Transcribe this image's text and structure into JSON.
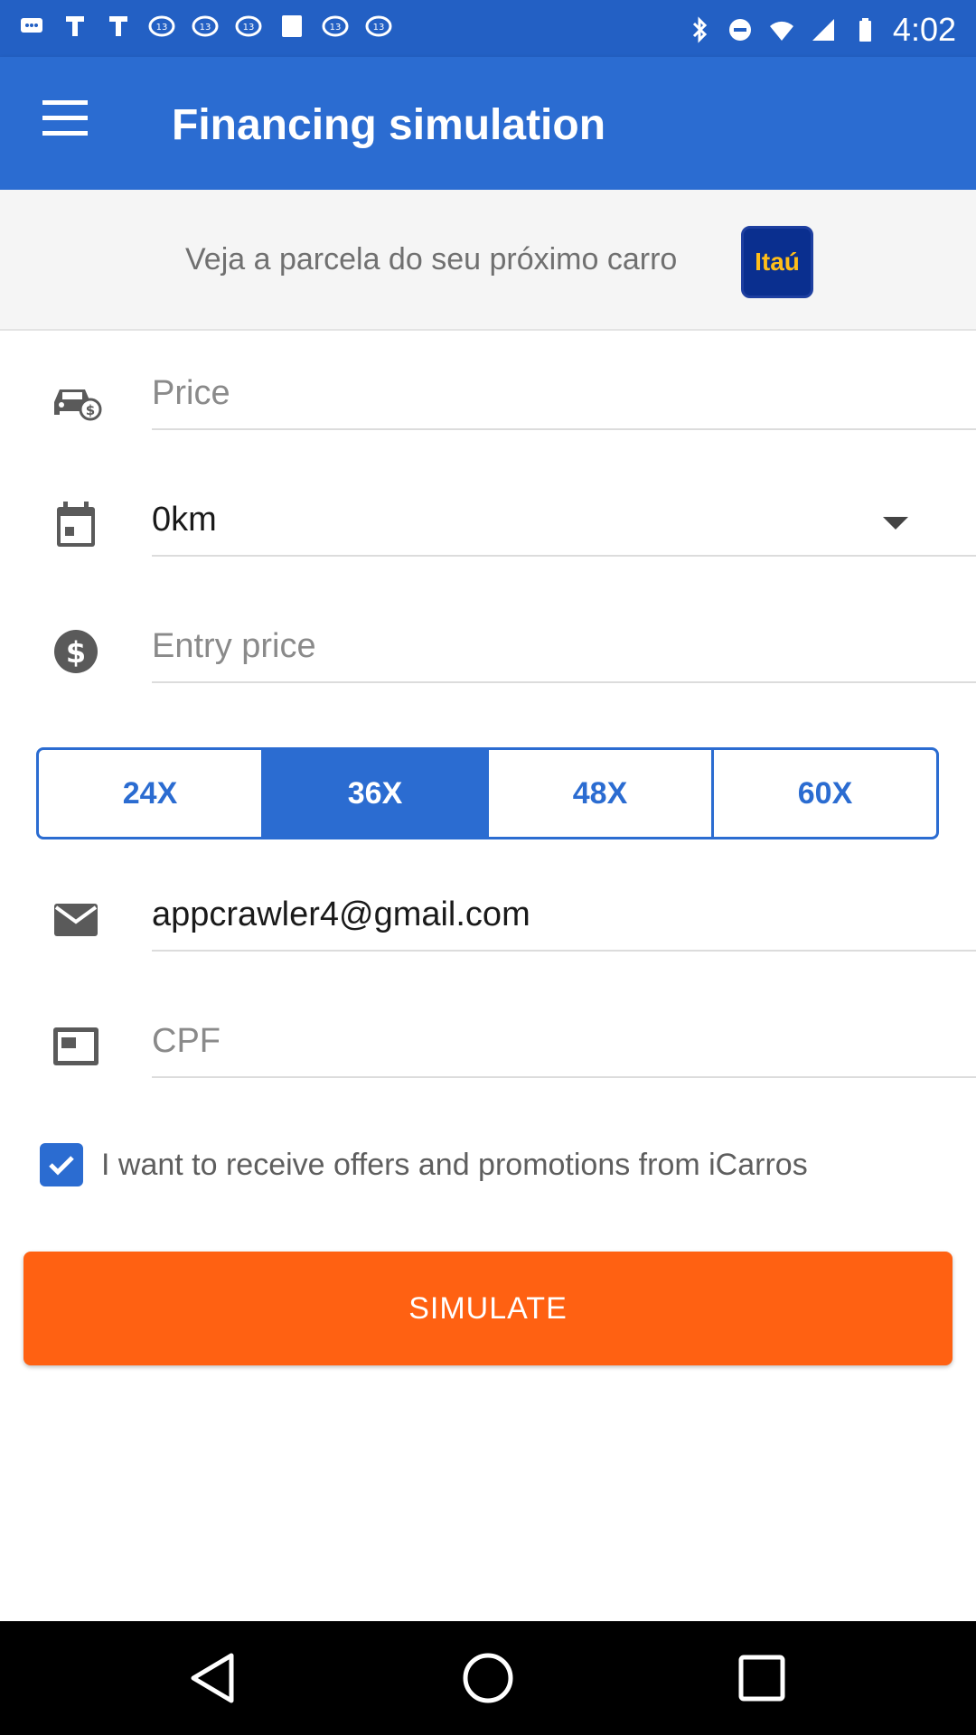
{
  "status_bar": {
    "time": "4:02",
    "left_icons": [
      "messages-icon",
      "notification-icon",
      "notification-icon",
      "tv-channel-icon",
      "tv-channel-icon",
      "tv-channel-icon",
      "blank-notification-icon",
      "tv-channel-icon",
      "tv-channel-icon"
    ],
    "right_icons": [
      "bluetooth-icon",
      "do-not-disturb-icon",
      "wifi-icon",
      "cellular-signal-icon",
      "battery-icon"
    ]
  },
  "app_bar": {
    "title": "Financing simulation",
    "menu_icon": "hamburger-menu-icon"
  },
  "banner": {
    "text": "Veja a parcela do seu próximo carro",
    "logo_text": "Itaú"
  },
  "form": {
    "price": {
      "placeholder": "Price",
      "icon": "car-price-icon"
    },
    "condition": {
      "value": "0km",
      "icon": "calendar-icon"
    },
    "entry_price": {
      "placeholder": "Entry price",
      "icon": "dollar-icon"
    },
    "email": {
      "value": "appcrawler4@gmail.com",
      "icon": "email-icon"
    },
    "cpf": {
      "placeholder": "CPF",
      "icon": "id-card-icon"
    }
  },
  "installments": {
    "options": [
      "24X",
      "36X",
      "48X",
      "60X"
    ],
    "selected": "36X"
  },
  "offers_checkbox": {
    "label": "I want to receive offers and promotions from iCarros",
    "checked": true
  },
  "simulate_button": {
    "label": "SIMULATE"
  },
  "colors": {
    "status_bar": "#2360c4",
    "primary": "#2b6cd1",
    "accent": "#ff6112",
    "itau_blue": "#0a2f8f",
    "itau_yellow": "#ffbe1a"
  }
}
